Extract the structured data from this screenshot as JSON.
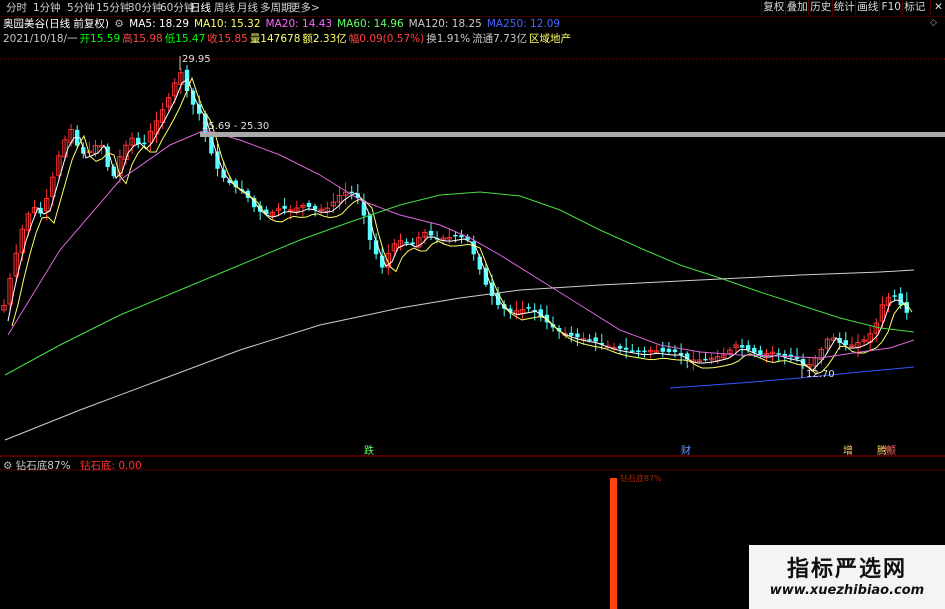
{
  "toolbar": {
    "periods": [
      {
        "label": "分时",
        "active": false
      },
      {
        "label": "1分钟",
        "active": false
      },
      {
        "label": "5分钟",
        "active": false
      },
      {
        "label": "15分钟",
        "active": false
      },
      {
        "label": "30分钟",
        "active": false
      },
      {
        "label": "60分钟",
        "active": false
      },
      {
        "label": "日线",
        "active": true
      },
      {
        "label": "周线",
        "active": false
      },
      {
        "label": "月线",
        "active": false
      },
      {
        "label": "多周期",
        "active": false
      },
      {
        "label": "更多>",
        "active": false
      }
    ],
    "right_buttons": [
      "复权",
      "叠加",
      "历史",
      "统计",
      "画线",
      "F10",
      "标记"
    ]
  },
  "header": {
    "stock": "奥园美谷(日线 前复权)",
    "ma": [
      {
        "label": "MA5: 18.29",
        "color": "#ffffff"
      },
      {
        "label": "MA10: 15.32",
        "color": "#ffff66"
      },
      {
        "label": "MA20: 14.43",
        "color": "#ff66ff"
      },
      {
        "label": "MA60: 14.96",
        "color": "#66ff66"
      },
      {
        "label": "MA120: 18.25",
        "color": "#c8c8c8"
      },
      {
        "label": "MA250: 12.09",
        "color": "#4466ff"
      }
    ]
  },
  "quote": [
    {
      "text": "2021/10/18/一",
      "color": "#c8c8c8"
    },
    {
      "text": "开15.59",
      "color": "#00ff00"
    },
    {
      "text": "高15.98",
      "color": "#ff4444"
    },
    {
      "text": "低15.47",
      "color": "#00ff00"
    },
    {
      "text": "收15.85",
      "color": "#ff4444"
    },
    {
      "text": "量147678",
      "color": "#ffff66"
    },
    {
      "text": "额2.33亿",
      "color": "#ffff66"
    },
    {
      "text": "幅0.09(0.57%)",
      "color": "#ff4444"
    },
    {
      "text": "换1.91%",
      "color": "#c8c8c8"
    },
    {
      "text": "流通7.73亿",
      "color": "#c8c8c8"
    },
    {
      "text": "区域地产",
      "color": "#ffff66"
    }
  ],
  "chart": {
    "price_high_label": "29.95",
    "price_low_label": "12.70",
    "range_label": "25.69 - 25.30",
    "markers": [
      {
        "text": "跌",
        "color": "#66ff66"
      },
      {
        "text": "财",
        "color": "#6699ff"
      },
      {
        "text": "增",
        "color": "#ffcc66"
      },
      {
        "text": "腾",
        "color": "#ffcc66"
      },
      {
        "text": "颤",
        "color": "#ff6666"
      }
    ]
  },
  "indicator": {
    "name": "钻石底87%",
    "series_label": "钻石底: 0.00",
    "bar_label": "钻石底87%",
    "bar_value": 1,
    "colors": {
      "bar": "#ff4411",
      "name": "#c8c8c8",
      "series": "#ff3333"
    }
  },
  "watermark": {
    "title": "指标严选网",
    "url": "www.xuezhibiao.com"
  }
}
